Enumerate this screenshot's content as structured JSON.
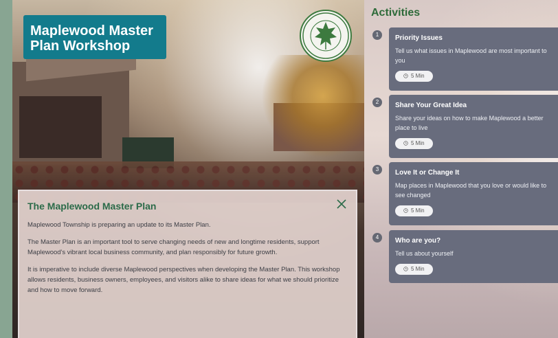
{
  "hero": {
    "title": "Maplewood Master Plan Workshop",
    "seal_text_top": "TOWNSHIP OF MAPLEWOOD",
    "seal_text_bottom": "ESSEX COUNTY • NEW JERSEY"
  },
  "dialog": {
    "title": "The Maplewood Master Plan",
    "paragraphs": [
      "Maplewood Township is preparing an update to its Master Plan.",
      "The Master Plan is an important tool to serve changing needs of new and longtime residents, support Maplewood's vibrant local business community, and plan responsibly for future growth.",
      "It is imperative to include diverse Maplewood perspectives when developing the Master Plan. This workshop allows residents, business owners, employees, and visitors alike to share ideas for what we should prioritize and how to move forward."
    ]
  },
  "activities": {
    "heading": "Activities",
    "items": [
      {
        "number": "1",
        "title": "Priority Issues",
        "description": "Tell us what issues in Maplewood are most important to you",
        "duration": "5 Min"
      },
      {
        "number": "2",
        "title": "Share Your Great Idea",
        "description": "Share your ideas on how to make Maplewood a better place to live",
        "duration": "5 Min"
      },
      {
        "number": "3",
        "title": "Love It or Change It",
        "description": "Map places in Maplewood that you love or would like to see changed",
        "duration": "5 Min"
      },
      {
        "number": "4",
        "title": "Who are you?",
        "description": "Tell us about yourself",
        "duration": "5 Min"
      }
    ]
  },
  "colors": {
    "title_bg": "#137b8c",
    "card_bg": "#686c7d",
    "heading_green": "#2e6b3a"
  },
  "icons": {
    "close": "close-icon",
    "clock": "clock-icon",
    "seal": "township-seal-logo"
  }
}
